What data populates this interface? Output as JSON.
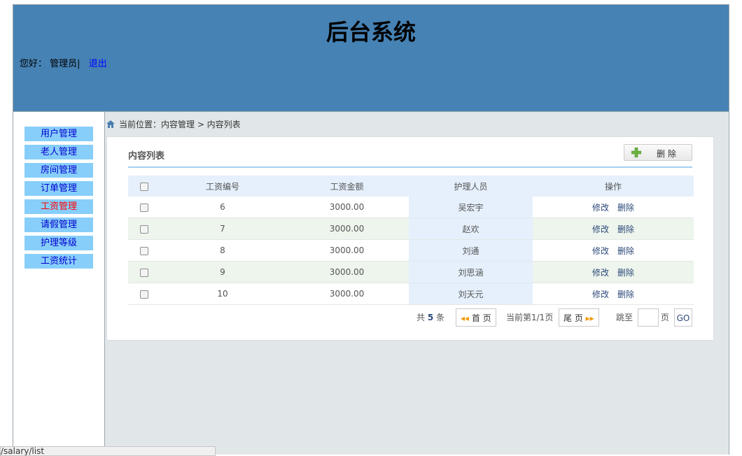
{
  "header": {
    "title": "后台系统",
    "greeting": "您好：",
    "user": "管理员|",
    "logout": "退出"
  },
  "sidebar": {
    "items": [
      {
        "label": "用户管理",
        "active": false
      },
      {
        "label": "老人管理",
        "active": false
      },
      {
        "label": "房间管理",
        "active": false
      },
      {
        "label": "订单管理",
        "active": false
      },
      {
        "label": "工资管理",
        "active": true
      },
      {
        "label": "请假管理",
        "active": false
      },
      {
        "label": "护理等级",
        "active": false
      },
      {
        "label": "工资统计",
        "active": false
      }
    ]
  },
  "breadcrumb": {
    "text": "当前位置：内容管理 > 内容列表"
  },
  "panel": {
    "title": "内容列表",
    "delete_button": "删除",
    "columns": [
      "工资编号",
      "工资金额",
      "护理人员",
      "操作"
    ],
    "rows": [
      {
        "id": "6",
        "amount": "3000.00",
        "nurse": "吴宏宇"
      },
      {
        "id": "7",
        "amount": "3000.00",
        "nurse": "赵欢"
      },
      {
        "id": "8",
        "amount": "3000.00",
        "nurse": "刘通"
      },
      {
        "id": "9",
        "amount": "3000.00",
        "nurse": "刘思涵"
      },
      {
        "id": "10",
        "amount": "3000.00",
        "nurse": "刘天元"
      }
    ],
    "row_actions": {
      "edit": "修改",
      "delete": "删除"
    }
  },
  "pager": {
    "total_prefix": "共",
    "total": "5",
    "total_suffix": "条",
    "first": "首 页",
    "current": "当前第1/1页",
    "last": "尾 页",
    "jump_label": "跳至",
    "page_unit": "页",
    "go": "GO"
  },
  "status_bar": {
    "url": "/salary/list"
  },
  "colors": {
    "header_bg": "#4682b4",
    "menu_bg": "#87cefa",
    "menu_text": "#0000cd",
    "menu_active": "#ff0000"
  }
}
